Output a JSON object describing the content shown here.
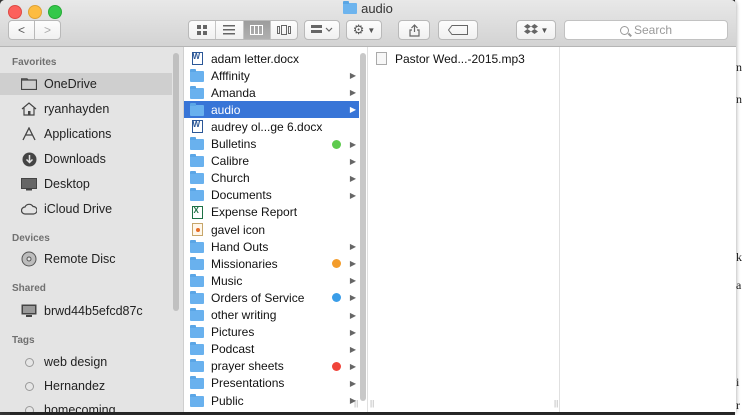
{
  "window": {
    "title": "audio"
  },
  "toolbar": {
    "back_label": "<",
    "forward_label": ">",
    "search_placeholder": "Search"
  },
  "sidebar": {
    "sections": {
      "favorites": "Favorites",
      "devices": "Devices",
      "shared": "Shared",
      "tags": "Tags"
    },
    "favorites": [
      {
        "label": "OneDrive",
        "icon": "folder-icon",
        "selected": true
      },
      {
        "label": "ryanhayden",
        "icon": "home-icon"
      },
      {
        "label": "Applications",
        "icon": "applications-icon"
      },
      {
        "label": "Downloads",
        "icon": "downloads-icon"
      },
      {
        "label": "Desktop",
        "icon": "desktop-icon"
      },
      {
        "label": "iCloud Drive",
        "icon": "cloud-icon"
      }
    ],
    "devices": [
      {
        "label": "Remote Disc",
        "icon": "disc-icon"
      }
    ],
    "shared": [
      {
        "label": "brwd44b5efcd87c",
        "icon": "monitor-icon"
      }
    ],
    "tags": [
      {
        "label": "web design"
      },
      {
        "label": "Hernandez"
      },
      {
        "label": "homecoming"
      }
    ]
  },
  "column1": {
    "items": [
      {
        "label": "adam letter.docx",
        "type": "docx"
      },
      {
        "label": "Afffinity",
        "type": "folder"
      },
      {
        "label": "Amanda",
        "type": "folder"
      },
      {
        "label": "audio",
        "type": "folder",
        "selected": true
      },
      {
        "label": "audrey ol...ge 6.docx",
        "type": "docx"
      },
      {
        "label": "Bulletins",
        "type": "folder",
        "tag_color": "#5ecb4e"
      },
      {
        "label": "Calibre",
        "type": "folder"
      },
      {
        "label": "Church",
        "type": "folder"
      },
      {
        "label": "Documents",
        "type": "folder"
      },
      {
        "label": "Expense Report",
        "type": "xls"
      },
      {
        "label": "gavel icon",
        "type": "img"
      },
      {
        "label": "Hand Outs",
        "type": "folder"
      },
      {
        "label": "Missionaries",
        "type": "folder",
        "tag_color": "#f39c2b"
      },
      {
        "label": "Music",
        "type": "folder"
      },
      {
        "label": "Orders of Service",
        "type": "folder",
        "tag_color": "#3a9de8"
      },
      {
        "label": "other writing",
        "type": "folder"
      },
      {
        "label": "Pictures",
        "type": "folder"
      },
      {
        "label": "Podcast",
        "type": "folder"
      },
      {
        "label": "prayer sheets",
        "type": "folder",
        "tag_color": "#f0443a"
      },
      {
        "label": "Presentations",
        "type": "folder"
      },
      {
        "label": "Public",
        "type": "folder"
      }
    ]
  },
  "column2": {
    "items": [
      {
        "label": "Pastor Wed...-2015.mp3",
        "type": "mp3"
      }
    ]
  },
  "background_doc_letters": [
    "n",
    "n",
    "k",
    "a",
    "i",
    "r"
  ]
}
